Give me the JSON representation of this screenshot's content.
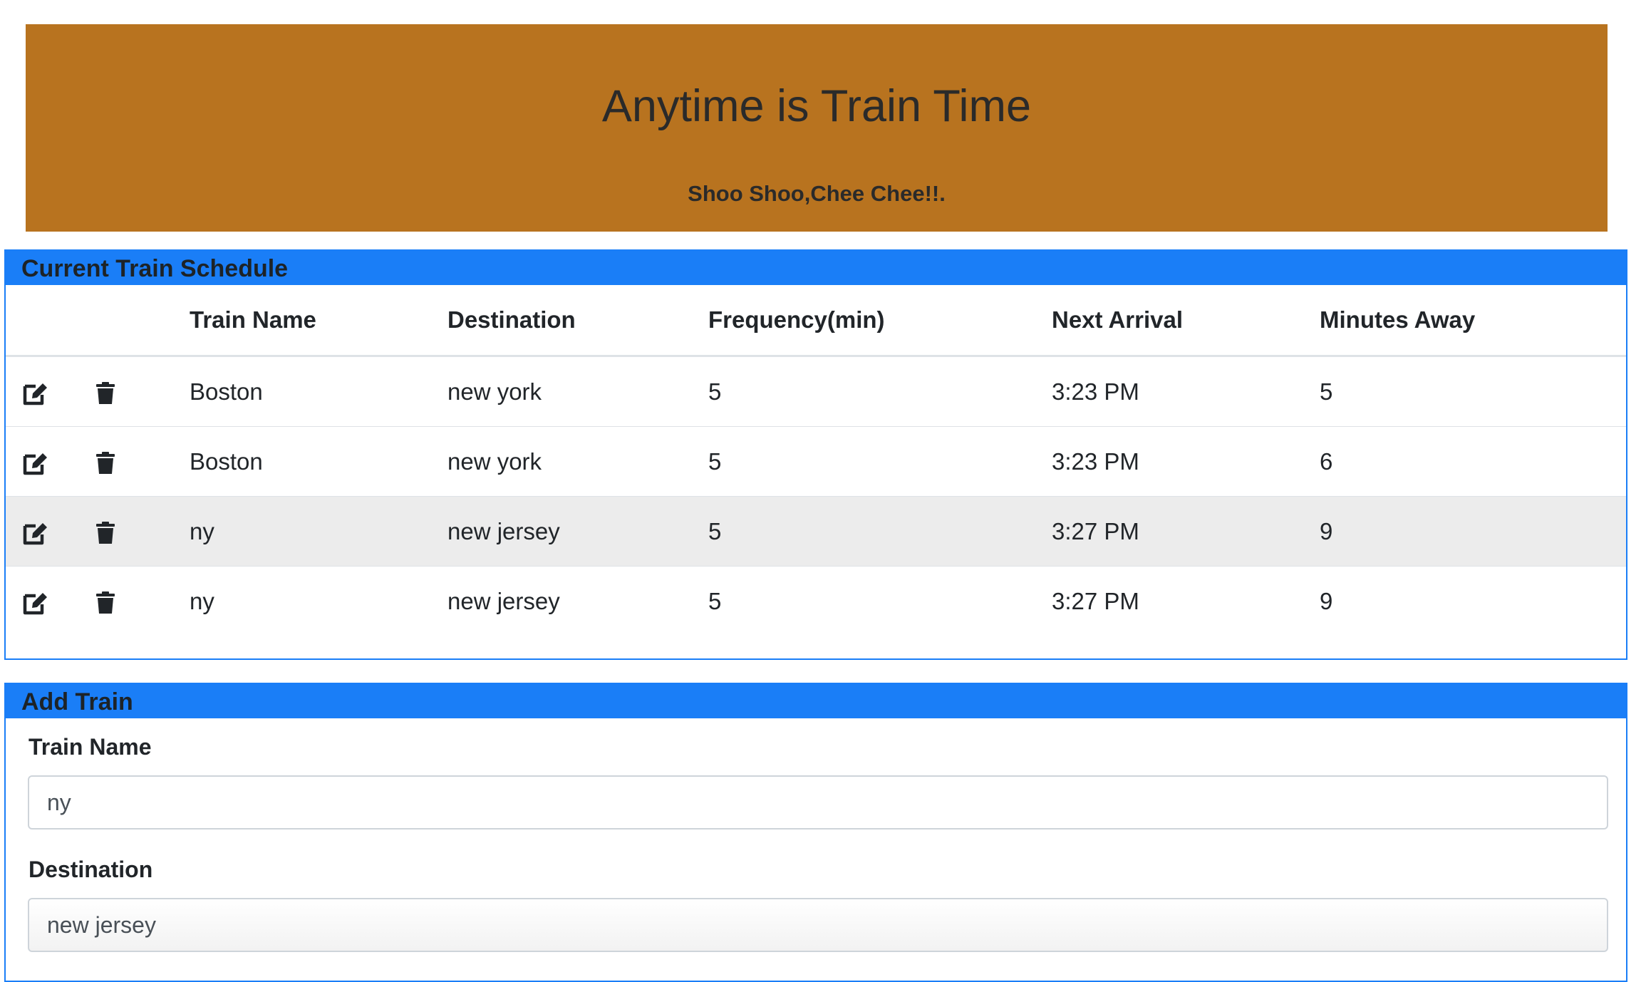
{
  "header": {
    "title": "Anytime is Train Time",
    "subtitle": "Shoo Shoo,Chee Chee!!.",
    "background_color": "#b8731f"
  },
  "schedule": {
    "heading": "Current Train Schedule",
    "accent_color": "#1a7ef7",
    "columns": [
      "",
      "",
      "Train Name",
      "Destination",
      "Frequency(min)",
      "Next Arrival",
      "Minutes Away"
    ],
    "rows": [
      {
        "train_name": "Boston",
        "destination": "new york",
        "frequency": "5",
        "next_arrival": "3:23 PM",
        "minutes_away": "5"
      },
      {
        "train_name": "Boston",
        "destination": "new york",
        "frequency": "5",
        "next_arrival": "3:23 PM",
        "minutes_away": "6"
      },
      {
        "train_name": "ny",
        "destination": "new jersey",
        "frequency": "5",
        "next_arrival": "3:27 PM",
        "minutes_away": "9"
      },
      {
        "train_name": "ny",
        "destination": "new jersey",
        "frequency": "5",
        "next_arrival": "3:27 PM",
        "minutes_away": "9"
      }
    ],
    "row_icons": {
      "edit": "edit-icon",
      "delete": "trash-icon"
    }
  },
  "add_train": {
    "heading": "Add Train",
    "train_name_label": "Train Name",
    "train_name_value": "ny",
    "destination_label": "Destination",
    "destination_value": "new jersey"
  }
}
